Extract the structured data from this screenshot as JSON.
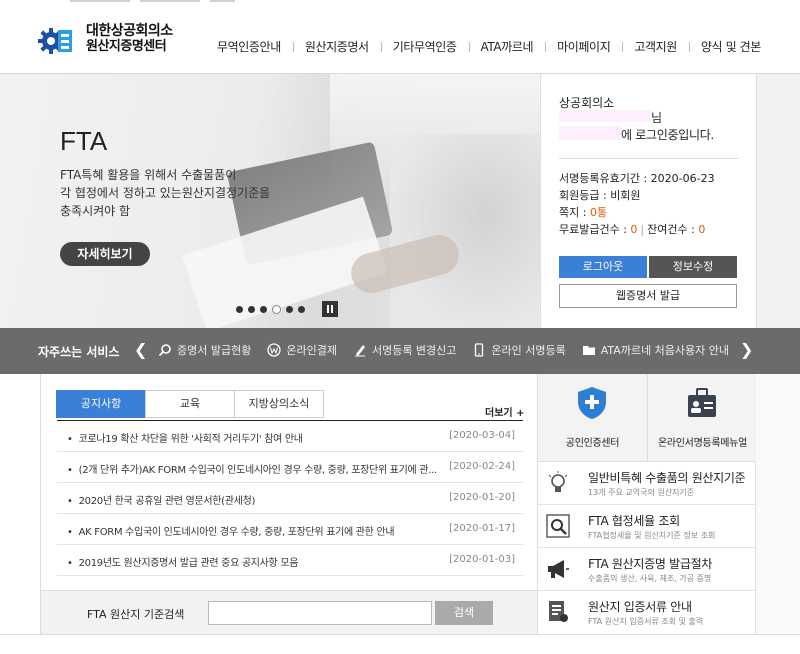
{
  "header": {
    "logo": {
      "line1": "대한상공회의소",
      "line2": "원산지증명센터"
    },
    "nav": [
      "무역인증안내",
      "원산지증명서",
      "기타무역인증",
      "ATA까르네",
      "마이페이지",
      "고객지원",
      "양식 및 견본"
    ]
  },
  "hero": {
    "title": "FTA",
    "desc": [
      "FTA특혜 활용을 위해서 수출물품이",
      "각 협정에서 정하고 있는원산지결정기준을",
      "충족시켜야 함"
    ],
    "button": "자세히보기",
    "slide_count": 6,
    "active_slide": 4
  },
  "login": {
    "org": "상공회의소",
    "suffix": "님",
    "message": "에 로그인중입니다.",
    "info": {
      "expire_label": "서명등록유효기간 : ",
      "expire_value": "2020-06-23",
      "grade_label": "회원등급 : ",
      "grade_value": "비회원",
      "note_label": "쪽지 : ",
      "note_value": "0통",
      "free_label": "무료발급건수 : ",
      "free_value": "0",
      "remain_label": "잔여건수 : ",
      "remain_value": "0"
    },
    "logout": "로그아웃",
    "edit": "정보수정",
    "web_cert": "웹증명서 발급"
  },
  "quick": {
    "title": "자주쓰는 서비스",
    "items": [
      {
        "label": "증명서 발급현황",
        "icon": "search-icon"
      },
      {
        "label": "온라인결제",
        "icon": "won-coin-icon"
      },
      {
        "label": "서명등록 변경신고",
        "icon": "pen-icon"
      },
      {
        "label": "온라인 서명등록",
        "icon": "mobile-icon"
      },
      {
        "label": "ATA까르네 처음사용자 안내",
        "icon": "folder-icon"
      }
    ]
  },
  "board": {
    "tabs": [
      "공지사항",
      "교육",
      "지방상의소식"
    ],
    "more": "더보기 +",
    "rows": [
      {
        "title": "코로나19 확산 차단을 위한 '사회적 거리두기' 참여 안내",
        "date": "[2020-03-04]"
      },
      {
        "title": "(2개 단위 추가)AK FORM 수입국이 인도네시아인 경우 수량, 중량, 포장단위 표기에 관...",
        "date": "[2020-02-24]"
      },
      {
        "title": "2020년 한국 공휴일 관련 영문서한(관세청)",
        "date": "[2020-01-20]"
      },
      {
        "title": "AK FORM 수입국이 인도네시아인 경우 수량, 중량, 포장단위 표기에 관한 안내",
        "date": "[2020-01-17]"
      },
      {
        "title": "2019년도 원산지증명서 발급 관련 중요 공지사항 모음",
        "date": "[2020-01-03]"
      }
    ],
    "search_label": "FTA 원산지 기준검색",
    "search_placeholder": "",
    "search_button": "검색"
  },
  "services": {
    "top": [
      {
        "label": "공인인증센터",
        "icon": "shield-plus-icon"
      },
      {
        "label": "온라인서명등록메뉴얼",
        "icon": "id-card-icon"
      }
    ],
    "items": [
      {
        "title": "일반비특혜 수출품의 원산지기준",
        "sub": "13개 주요 교역국의 원산지기준",
        "icon": "lightbulb-icon"
      },
      {
        "title": "FTA 협정세율 조회",
        "sub": "FTA협정세율 및 원산지기준 정보 조회",
        "icon": "magnifier-icon"
      },
      {
        "title": "FTA 원산지증명 발급절차",
        "sub": "수출품의 생산, 사육, 제조, 가공 증명",
        "icon": "megaphone-icon"
      },
      {
        "title": "원산지 입증서류 안내",
        "sub": "FTA 원산지 입증서류 조회 및 출력",
        "icon": "document-icon"
      }
    ]
  },
  "colors": {
    "accent": "#3a7fd8",
    "bar": "#6b6b6b",
    "highlight": "#e05a00"
  }
}
